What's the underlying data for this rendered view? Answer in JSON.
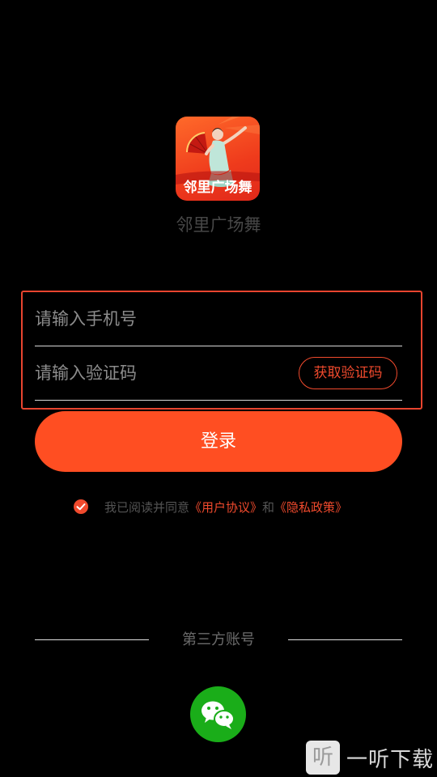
{
  "app": {
    "logo_caption": "邻里广场舞",
    "name": "邻里广场舞"
  },
  "form": {
    "phone_placeholder": "请输入手机号",
    "code_placeholder": "请输入验证码",
    "get_code_label": "获取验证码",
    "login_label": "登录"
  },
  "agreement": {
    "checked": true,
    "prefix": "我已阅读并同意",
    "user_agreement": "《用户协议》",
    "and": "和",
    "privacy_policy": "《隐私政策》"
  },
  "third_party": {
    "label": "第三方账号",
    "providers": [
      {
        "icon": "wechat-icon",
        "color": "#1aad19"
      }
    ]
  },
  "watermark": {
    "icon_glyph": "听",
    "text": "一听下载"
  },
  "colors": {
    "accent": "#ff4e22",
    "highlight_border": "#e8452f",
    "wechat": "#1aad19",
    "background": "#000000"
  }
}
